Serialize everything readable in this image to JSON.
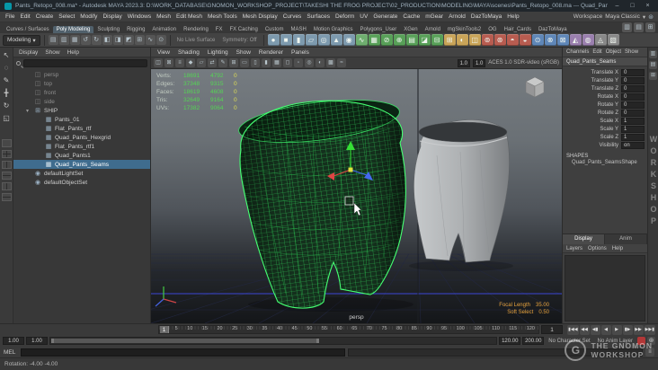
{
  "window": {
    "title": "Pants_Retopo_008.ma* - Autodesk MAYA 2023.3: D:\\WORK_DATABASE\\GNOMON_WORKSHOP_PROJECT\\TAKESHI THE FROG PROJECT\\02_PRODUCTION\\MODELING\\MAYA\\scenes\\Pants_Retopo_008.ma --- Quad_Pants_Seams",
    "controls": {
      "minimize": "–",
      "maximize": "□",
      "close": "×"
    }
  },
  "menu_bar": {
    "items": [
      "File",
      "Edit",
      "Create",
      "Select",
      "Modify",
      "Display",
      "Windows",
      "Mesh",
      "Edit Mesh",
      "Mesh Tools",
      "Mesh Display",
      "Curves",
      "Surfaces",
      "Deform",
      "UV",
      "Generate",
      "Cache",
      "mGear",
      "Arnold",
      "DazToMaya",
      "Help"
    ],
    "workspace_label": "Workspace",
    "workspace_value": "Maya Classic",
    "gear_glyph": "⊛"
  },
  "shelf": {
    "tabs": [
      {
        "label": "Curves / Surfaces"
      },
      {
        "label": "Poly Modeling",
        "class": "active"
      },
      {
        "label": "Sculpting"
      },
      {
        "label": "Rigging"
      },
      {
        "label": "Animation"
      },
      {
        "label": "Rendering"
      },
      {
        "label": "FX"
      },
      {
        "label": "FX Caching"
      },
      {
        "label": "Custom"
      },
      {
        "label": "MASH"
      },
      {
        "label": "Motion Graphics"
      },
      {
        "label": "Polygons_User"
      },
      {
        "label": "XGen"
      },
      {
        "label": "Arnold"
      },
      {
        "label": "mgSkinTools2"
      },
      {
        "label": "OG"
      },
      {
        "label": "Hair_Cards"
      },
      {
        "label": "DazToMaya"
      }
    ],
    "icons": [
      {
        "name": "poly-sphere-icon",
        "glyph": "●",
        "color": "#7d9aae"
      },
      {
        "name": "poly-cube-icon",
        "glyph": "■",
        "color": "#7d9aae"
      },
      {
        "name": "poly-cylinder-icon",
        "glyph": "▮",
        "color": "#7d9aae"
      },
      {
        "name": "poly-plane-icon",
        "glyph": "▱",
        "color": "#7d9aae"
      },
      {
        "name": "poly-torus-icon",
        "glyph": "◎",
        "color": "#7d9aae"
      },
      {
        "name": "poly-cone-icon",
        "glyph": "▲",
        "color": "#7d9aae"
      },
      {
        "name": "poly-disc-icon",
        "glyph": "◉",
        "color": "#7d9aae"
      },
      {
        "name": "ep-curve-tool-icon",
        "glyph": "∿",
        "color": "#6fae6f"
      },
      {
        "name": "quad-draw-icon",
        "glyph": "▦",
        "color": "#58a058"
      },
      {
        "name": "multi-cut-icon",
        "glyph": "⊘",
        "color": "#58a058"
      },
      {
        "name": "target-weld-icon",
        "glyph": "⊕",
        "color": "#58a058"
      },
      {
        "name": "insert-edge-loop-icon",
        "glyph": "▤",
        "color": "#58a058"
      },
      {
        "name": "bevel-icon",
        "glyph": "◪",
        "color": "#58a058"
      },
      {
        "name": "bridge-icon",
        "glyph": "⊟",
        "color": "#58a058"
      },
      {
        "name": "extrude-icon",
        "glyph": "⊞",
        "color": "#c9a458"
      },
      {
        "name": "smooth-icon",
        "glyph": "◐",
        "color": "#c9a458"
      },
      {
        "name": "mirror-icon",
        "glyph": "◫",
        "color": "#c9a458"
      },
      {
        "name": "combine-icon",
        "glyph": "⊚",
        "color": "#b85c50"
      },
      {
        "name": "separate-icon",
        "glyph": "⊛",
        "color": "#b85c50"
      },
      {
        "name": "boolean-union-icon",
        "glyph": "◓",
        "color": "#b85c50"
      },
      {
        "name": "boolean-difference-icon",
        "glyph": "◒",
        "color": "#b85c50"
      },
      {
        "name": "center-pivot-icon",
        "glyph": "⊙",
        "color": "#5f87b8"
      },
      {
        "name": "delete-history-icon",
        "glyph": "⊗",
        "color": "#5f87b8"
      },
      {
        "name": "freeze-transformations-icon",
        "glyph": "⊠",
        "color": "#5f87b8"
      },
      {
        "name": "sculpt-tool-icon",
        "glyph": "◭",
        "color": "#9a7fae"
      },
      {
        "name": "soft-select-icon",
        "glyph": "◍",
        "color": "#9a7fae"
      },
      {
        "name": "snap-together-icon",
        "glyph": "◬",
        "color": "#888888"
      },
      {
        "name": "uv-editor-icon",
        "glyph": "▧",
        "color": "#888888"
      }
    ]
  },
  "status_line": {
    "menuset": "Modeling",
    "dropdown_arrow": "▾",
    "live_surface": "No Live Surface",
    "symmetry": "Symmetry: Off",
    "icons": [
      {
        "name": "new-scene-icon",
        "glyph": "▤"
      },
      {
        "name": "open-scene-icon",
        "glyph": "▥"
      },
      {
        "name": "save-scene-icon",
        "glyph": "▦"
      },
      {
        "name": "undo-icon",
        "glyph": "↺"
      },
      {
        "name": "redo-icon",
        "glyph": "↻"
      },
      {
        "name": "select-by-hierarchy-icon",
        "glyph": "◧"
      },
      {
        "name": "select-by-object-icon",
        "glyph": "◨"
      },
      {
        "name": "select-by-component-icon",
        "glyph": "◩"
      },
      {
        "name": "snap-to-grids-icon",
        "glyph": "⊞"
      },
      {
        "name": "snap-to-curves-icon",
        "glyph": "∿"
      },
      {
        "name": "snap-to-points-icon",
        "glyph": "⊙"
      }
    ]
  },
  "left_toolbar": {
    "tools": [
      {
        "name": "select-tool-icon",
        "glyph": "↖"
      },
      {
        "name": "lasso-tool-icon",
        "glyph": "◌"
      },
      {
        "name": "paint-select-tool-icon",
        "glyph": "✎"
      },
      {
        "name": "move-tool-icon",
        "glyph": "╋"
      },
      {
        "name": "rotate-tool-icon",
        "glyph": "↻"
      },
      {
        "name": "scale-tool-icon",
        "glyph": "◱"
      }
    ],
    "layouts": [
      {
        "name": "single-pane-layout-button",
        "class": "q"
      },
      {
        "name": "four-pane-layout-button",
        "class": "g"
      },
      {
        "name": "persp-outliner-layout-button",
        "class": "v"
      },
      {
        "name": "two-pane-stacked-layout-button",
        "class": "h"
      },
      {
        "name": "persp-uv-layout-button",
        "class": "v"
      },
      {
        "name": "persp-graph-layout-button",
        "class": "h"
      }
    ]
  },
  "outliner": {
    "menus": [
      "Display",
      "Show",
      "Help"
    ],
    "search_placeholder": "",
    "items": [
      {
        "name": "outliner-item-persp",
        "tw": "",
        "glyph": "◫",
        "label": "persp",
        "class": "muted"
      },
      {
        "name": "outliner-item-top",
        "tw": "",
        "glyph": "◫",
        "label": "top",
        "class": "muted"
      },
      {
        "name": "outliner-item-front",
        "tw": "",
        "glyph": "◫",
        "label": "front",
        "class": "muted"
      },
      {
        "name": "outliner-item-side",
        "tw": "",
        "glyph": "◫",
        "label": "side",
        "class": "muted"
      },
      {
        "name": "outliner-item-ship",
        "tw": "▾",
        "glyph": "⊞",
        "label": "SHIP"
      },
      {
        "name": "outliner-item-pants-01",
        "tw": "",
        "glyph": "▦",
        "label": "Pants_01",
        "class": "ind1"
      },
      {
        "name": "outliner-item-flat-pants-rtf",
        "tw": "",
        "glyph": "▦",
        "label": "Flat_Pants_rtf",
        "class": "ind1"
      },
      {
        "name": "outliner-item-quad-pants-hexgrid",
        "tw": "",
        "glyph": "▦",
        "label": "Quad_Pants_Hexgrid",
        "class": "ind1"
      },
      {
        "name": "outliner-item-flat-pants-rtf1",
        "tw": "",
        "glyph": "▦",
        "label": "Flat_Pants_rtf1",
        "class": "ind1"
      },
      {
        "name": "outliner-item-quad-pants1",
        "tw": "",
        "glyph": "▦",
        "label": "Quad_Pants1",
        "class": "ind1"
      },
      {
        "name": "outliner-item-quad-pants-seams",
        "tw": "",
        "glyph": "▦",
        "label": "Quad_Pants_Seams",
        "class": "ind1 selected"
      },
      {
        "name": "outliner-item-default-light-set",
        "tw": "",
        "glyph": "◉",
        "label": "defaultLightSet"
      },
      {
        "name": "outliner-item-default-object-set",
        "tw": "",
        "glyph": "◉",
        "label": "defaultObjectSet"
      }
    ]
  },
  "viewport": {
    "menus": [
      "View",
      "Shading",
      "Lighting",
      "Show",
      "Renderer",
      "Panels"
    ],
    "toolbar_icons": [
      {
        "name": "select-camera-icon",
        "glyph": "◫"
      },
      {
        "name": "lock-camera-icon",
        "glyph": "⊠"
      },
      {
        "name": "camera-attributes-icon",
        "glyph": "≡"
      },
      {
        "name": "bookmarks-icon",
        "glyph": "◆"
      },
      {
        "name": "image-plane-icon",
        "glyph": "▱"
      },
      {
        "name": "2d-pan-zoom-icon",
        "glyph": "⇄"
      },
      {
        "name": "grease-pencil-icon",
        "glyph": "✎"
      },
      {
        "name": "grid-toggle-icon",
        "glyph": "⊞"
      },
      {
        "name": "film-gate-icon",
        "glyph": "▭"
      },
      {
        "name": "resolution-gate-icon",
        "glyph": "▯"
      },
      {
        "name": "gate-mask-icon",
        "glyph": "▮"
      },
      {
        "name": "field-chart-icon",
        "glyph": "▦"
      },
      {
        "name": "safe-action-icon",
        "glyph": "◻"
      },
      {
        "name": "safe-title-icon",
        "glyph": "▫"
      },
      {
        "name": "isolate-select-icon",
        "glyph": "◎"
      },
      {
        "name": "xray-icon",
        "glyph": "◐"
      },
      {
        "name": "wireframe-on-shaded-icon",
        "glyph": "▩"
      },
      {
        "name": "anti-aliasing-icon",
        "glyph": "≈"
      }
    ],
    "exposure": "1.0",
    "gamma": "1.0",
    "color_space": "ACES 1.0 SDR-video (sRGB)",
    "hud_rows": [
      {
        "label": "Verts:",
        "v1": "18691",
        "v2": "4792",
        "v3": "0"
      },
      {
        "label": "Edges:",
        "v1": "37348",
        "v2": "9315",
        "v3": "0"
      },
      {
        "label": "Faces:",
        "v1": "18619",
        "v2": "4608",
        "v3": "0"
      },
      {
        "label": "Tris:",
        "v1": "32649",
        "v2": "9164",
        "v3": "0"
      },
      {
        "label": "UVs:",
        "v1": "17382",
        "v2": "9064",
        "v3": "0"
      }
    ],
    "camera_label": "persp",
    "cam_hud": [
      {
        "label": "Focal Length",
        "value": "35.00"
      },
      {
        "label": "Soft Select",
        "value": "0.50"
      }
    ]
  },
  "channel_box": {
    "menus": [
      "Channels",
      "Edit",
      "Object",
      "Show"
    ],
    "object_name": "Quad_Pants_Seams",
    "channels": [
      {
        "name": "Translate X",
        "value": "0"
      },
      {
        "name": "Translate Y",
        "value": "0"
      },
      {
        "name": "Translate Z",
        "value": "0"
      },
      {
        "name": "Rotate X",
        "value": "0"
      },
      {
        "name": "Rotate Y",
        "value": "0"
      },
      {
        "name": "Rotate Z",
        "value": "0"
      },
      {
        "name": "Scale X",
        "value": "1"
      },
      {
        "name": "Scale Y",
        "value": "1"
      },
      {
        "name": "Scale Z",
        "value": "1"
      },
      {
        "name": "Visibility",
        "value": "on"
      }
    ],
    "shapes_header": "SHAPES",
    "shape_name": "Quad_Pants_SeamsShape"
  },
  "layer_editor": {
    "tabs": [
      {
        "name": "layer-tab-display",
        "label": "Display",
        "class": "active"
      },
      {
        "name": "layer-tab-anim",
        "label": "Anim"
      }
    ],
    "menus": [
      "Layers",
      "Options",
      "Help"
    ]
  },
  "right_strip": {
    "icons": [
      {
        "name": "channel-box-toggle-icon",
        "glyph": "▥"
      },
      {
        "name": "attribute-editor-toggle-icon",
        "glyph": "▤"
      },
      {
        "name": "tool-settings-toggle-icon",
        "glyph": "⊞"
      }
    ]
  },
  "time_slider": {
    "ticks": [
      "1",
      "5",
      "10",
      "15",
      "20",
      "25",
      "30",
      "35",
      "40",
      "45",
      "50",
      "55",
      "60",
      "65",
      "70",
      "75",
      "80",
      "85",
      "90",
      "95",
      "100",
      "105",
      "110",
      "115",
      "120"
    ],
    "current_frame": "1",
    "current_time_field": "1"
  },
  "playback": {
    "buttons": [
      {
        "name": "go-to-start-button",
        "glyph": "▮◀◀"
      },
      {
        "name": "step-back-key-button",
        "glyph": "◀◀"
      },
      {
        "name": "step-back-frame-button",
        "glyph": "◀▮"
      },
      {
        "name": "play-backwards-button",
        "glyph": "◀"
      },
      {
        "name": "play-forwards-button",
        "glyph": "▶"
      },
      {
        "name": "step-forward-frame-button",
        "glyph": "▮▶"
      },
      {
        "name": "step-forward-key-button",
        "glyph": "▶▶"
      },
      {
        "name": "go-to-end-button",
        "glyph": "▶▶▮"
      }
    ]
  },
  "range_slider": {
    "anim_start": "1.00",
    "playback_start": "1.00",
    "playback_end": "120.00",
    "anim_end": "200.00",
    "character_set": "No Character Set",
    "anim_layer": "No Anim Layer"
  },
  "command_line": {
    "label": "MEL"
  },
  "help_line": {
    "text": "Rotation: -4.00 -4.00"
  },
  "watermark": {
    "vertical": "WORKSHOP",
    "line1": "THE GNOMON",
    "line2": "WORKSHOP"
  },
  "colors": {
    "selection_blue": "#3f6c8e",
    "wireframe_green": "#3ae065",
    "hud_value_green": "#55d455",
    "hud_value_yellow": "#dede55",
    "camera_hud_orange": "#e8a33d",
    "maya_teal": "#0696a7"
  }
}
